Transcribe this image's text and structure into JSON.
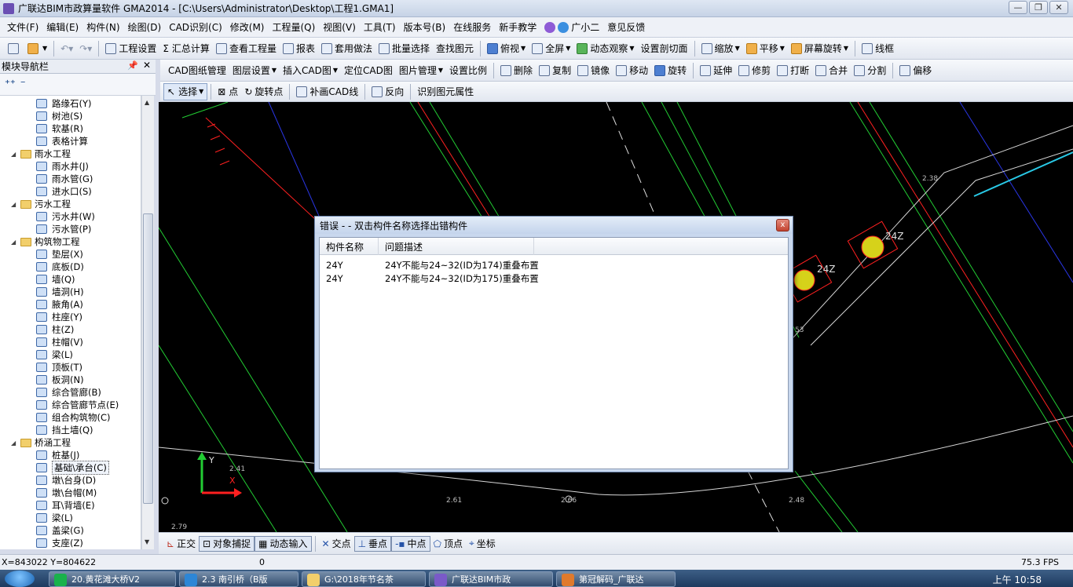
{
  "window": {
    "title": "广联达BIM市政算量软件 GMA2014 - [C:\\Users\\Administrator\\Desktop\\工程1.GMA1]",
    "min": "—",
    "max": "❐",
    "close": "✕"
  },
  "menu": [
    "文件(F)",
    "编辑(E)",
    "构件(N)",
    "绘图(D)",
    "CAD识别(C)",
    "修改(M)",
    "工程量(Q)",
    "视图(V)",
    "工具(T)",
    "版本号(B)",
    "在线服务",
    "新手教学",
    "广小二",
    "意见反馈"
  ],
  "toolbar1": [
    "工程设置",
    "汇总计算",
    "查看工程量",
    "报表",
    "套用做法",
    "批量选择",
    "查找图元",
    "俯视",
    "全屏",
    "动态观察",
    "设置剖切面",
    "缩放",
    "平移",
    "屏幕旋转",
    "线框"
  ],
  "toolbar2": [
    "CAD图纸管理",
    "图层设置",
    "插入CAD图",
    "定位CAD图",
    "图片管理",
    "设置比例",
    "删除",
    "复制",
    "镜像",
    "移动",
    "旋转",
    "延伸",
    "修剪",
    "打断",
    "合并",
    "分割",
    "偏移"
  ],
  "toolbar3": [
    "选择",
    "点",
    "旋转点",
    "补画CAD线",
    "反向",
    "识别图元属性"
  ],
  "nav": {
    "title": "模块导航栏",
    "pin": "📌",
    "close": "✕",
    "tools": [
      "⁺⁺",
      "⁻"
    ]
  },
  "tree": [
    {
      "type": "leaf",
      "label": "路缘石(Y)"
    },
    {
      "type": "leaf",
      "label": "树池(S)"
    },
    {
      "type": "leaf",
      "label": "软基(R)"
    },
    {
      "type": "leaf",
      "label": "表格计算"
    },
    {
      "type": "folder",
      "label": "雨水工程"
    },
    {
      "type": "leaf",
      "label": "雨水井(J)"
    },
    {
      "type": "leaf",
      "label": "雨水管(G)"
    },
    {
      "type": "leaf",
      "label": "进水口(S)"
    },
    {
      "type": "folder",
      "label": "污水工程"
    },
    {
      "type": "leaf",
      "label": "污水井(W)"
    },
    {
      "type": "leaf",
      "label": "污水管(P)"
    },
    {
      "type": "folder",
      "label": "构筑物工程"
    },
    {
      "type": "leaf",
      "label": "垫层(X)"
    },
    {
      "type": "leaf",
      "label": "底板(D)"
    },
    {
      "type": "leaf",
      "label": "墙(Q)"
    },
    {
      "type": "leaf",
      "label": "墙洞(H)"
    },
    {
      "type": "leaf",
      "label": "腋角(A)"
    },
    {
      "type": "leaf",
      "label": "柱座(Y)"
    },
    {
      "type": "leaf",
      "label": "柱(Z)"
    },
    {
      "type": "leaf",
      "label": "柱帽(V)"
    },
    {
      "type": "leaf",
      "label": "梁(L)"
    },
    {
      "type": "leaf",
      "label": "顶板(T)"
    },
    {
      "type": "leaf",
      "label": "板洞(N)"
    },
    {
      "type": "leaf",
      "label": "综合管廊(B)"
    },
    {
      "type": "leaf",
      "label": "综合管廊节点(E)"
    },
    {
      "type": "leaf",
      "label": "组合构筑物(C)"
    },
    {
      "type": "leaf",
      "label": "挡土墙(Q)"
    },
    {
      "type": "folder",
      "label": "桥涵工程"
    },
    {
      "type": "leaf",
      "label": "桩基(J)"
    },
    {
      "type": "leaf",
      "label": "基础\\承台(C)",
      "selected": true
    },
    {
      "type": "leaf",
      "label": "墩\\台身(D)"
    },
    {
      "type": "leaf",
      "label": "墩\\台帽(M)"
    },
    {
      "type": "leaf",
      "label": "耳\\背墙(E)"
    },
    {
      "type": "leaf",
      "label": "梁(L)"
    },
    {
      "type": "leaf",
      "label": "盖梁(G)"
    },
    {
      "type": "leaf",
      "label": "支座(Z)"
    }
  ],
  "canvas_labels": {
    "axis_y": "Y",
    "axis_x": "X",
    "ann_24z_1": "24Z",
    "ann_24z_2": "24Z",
    "n238": "2.38",
    "n241": "2.41",
    "n261": "2.61",
    "n266": "2.66",
    "n248": "2.48",
    "n279": "2.79",
    "n53": "53"
  },
  "dialog": {
    "title": "错误 - - 双击构件名称选择出错构件",
    "close": "x",
    "columns": [
      "构件名称",
      "问题描述"
    ],
    "rows": [
      {
        "name": "24Y",
        "desc": "24Y不能与24~32(ID为174)重叠布置"
      },
      {
        "name": "24Y",
        "desc": "24Y不能与24~32(ID为175)重叠布置"
      }
    ]
  },
  "snapbar": [
    "正交",
    "对象捕捉",
    "动态输入",
    "交点",
    "垂点",
    "中点",
    "顶点",
    "坐标"
  ],
  "status": {
    "coords": "X=843022 Y=804622",
    "value": "0",
    "fps": "75.3 FPS"
  },
  "taskbar": {
    "tasks": [
      "20.黄花滩大桥V2",
      "2.3 南引桥（B版",
      "G:\\2018年节名茶",
      "广联达BIM市政",
      "第冠解码_广联达"
    ],
    "time": "上午 10:58"
  },
  "colors": {
    "canvas_bg": "#000000",
    "cad_green": "#22cc33",
    "cad_red": "#ff2020",
    "cad_blue": "#2a36e6",
    "cad_cyan": "#29c9e6",
    "cad_white": "#e0e0e0",
    "pile_fill": "#d6d21a"
  }
}
